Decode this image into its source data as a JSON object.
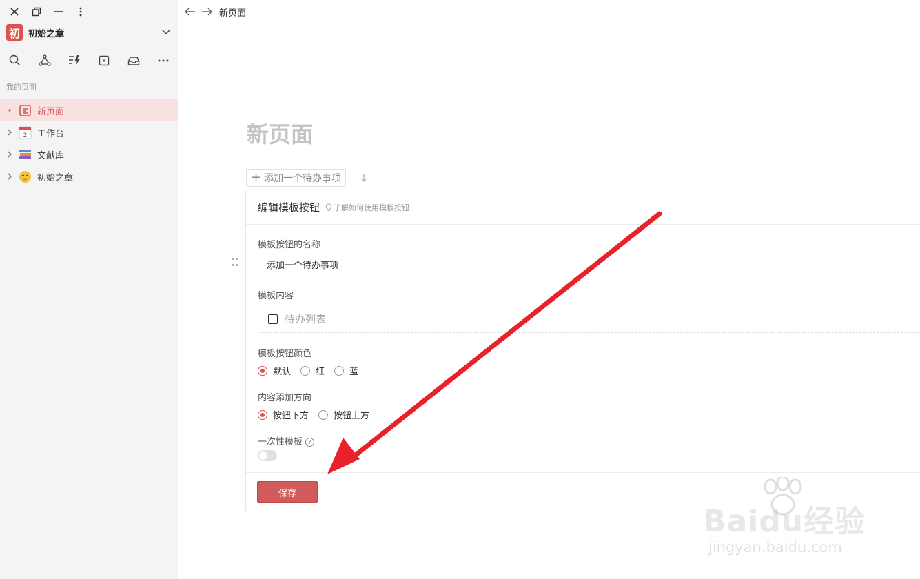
{
  "sidebar": {
    "workspace": {
      "logo_char": "初",
      "name": "初始之章"
    },
    "section_label": "我的页面",
    "items": [
      {
        "label": "新页面",
        "icon": "page-icon",
        "active": true
      },
      {
        "label": "工作台",
        "icon": "calendar-icon",
        "active": false
      },
      {
        "label": "文献库",
        "icon": "books-icon",
        "active": false
      },
      {
        "label": "初始之章",
        "icon": "smile-emoji-icon",
        "active": false
      }
    ]
  },
  "topbar": {
    "breadcrumb": "新页面"
  },
  "page": {
    "title": "新页面",
    "template_button_label": "添加一个待办事项"
  },
  "editor": {
    "title": "编辑模板按钮",
    "help_link": "了解如何使用模板按钮",
    "name_label": "模板按钮的名称",
    "name_value": "添加一个待办事项",
    "content_label": "模板内容",
    "todo_text": "待办列表",
    "color_label": "模板按钮颜色",
    "color_options": [
      "默认",
      "红",
      "蓝"
    ],
    "color_selected": "默认",
    "direction_label": "内容添加方向",
    "direction_options": [
      "按钮下方",
      "按钮上方"
    ],
    "direction_selected": "按钮下方",
    "once_label": "一次性模板",
    "once_enabled": false,
    "save_label": "保存"
  },
  "colors": {
    "accent": "#d9534f",
    "annotation_arrow": "#e8222a"
  },
  "watermark": {
    "logo": "Baidu经验",
    "url": "jingyan.baidu.com"
  }
}
